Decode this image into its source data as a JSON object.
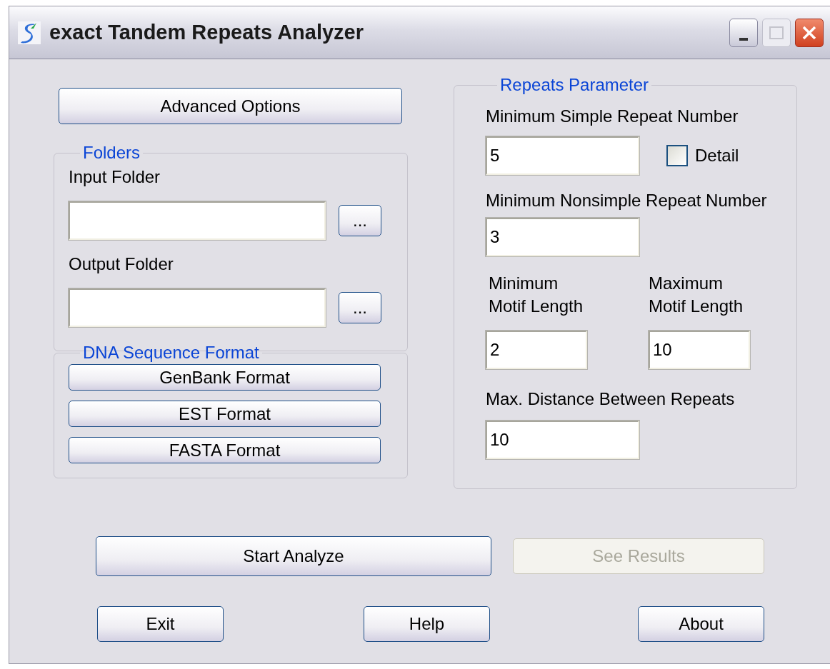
{
  "window": {
    "title": "exact Tandem Repeats Analyzer"
  },
  "advanced_button": {
    "label": "Advanced Options"
  },
  "folders": {
    "title": "Folders",
    "fields": [
      {
        "label": "Input Folder",
        "browse": "..."
      },
      {
        "label": "Output Folder",
        "browse": "..."
      }
    ]
  },
  "dna_format": {
    "title": "DNA Sequence Format",
    "buttons": [
      "GenBank Format",
      "EST Format",
      "FASTA Format"
    ]
  },
  "repeats": {
    "title": "Repeats Parameter",
    "min_simple": {
      "label": "Minimum Simple Repeat Number",
      "value": "5"
    },
    "detail": {
      "label": "Detail",
      "checked": false
    },
    "min_nonsimple": {
      "label": "Minimum Nonsimple Repeat Number",
      "value": "3"
    },
    "motif": [
      {
        "label_lines": [
          "Minimum",
          "Motif Length"
        ],
        "value": "2"
      },
      {
        "label_lines": [
          "Maximum",
          "Motif Length"
        ],
        "value": "10"
      }
    ],
    "max_distance": {
      "label": "Max. Distance Between Repeats",
      "value": "10"
    }
  },
  "actions": [
    {
      "label": "Start Analyze",
      "disabled": false
    },
    {
      "label": "See Results",
      "disabled": true
    }
  ],
  "bottom_buttons": [
    "Exit",
    "Help",
    "About"
  ]
}
